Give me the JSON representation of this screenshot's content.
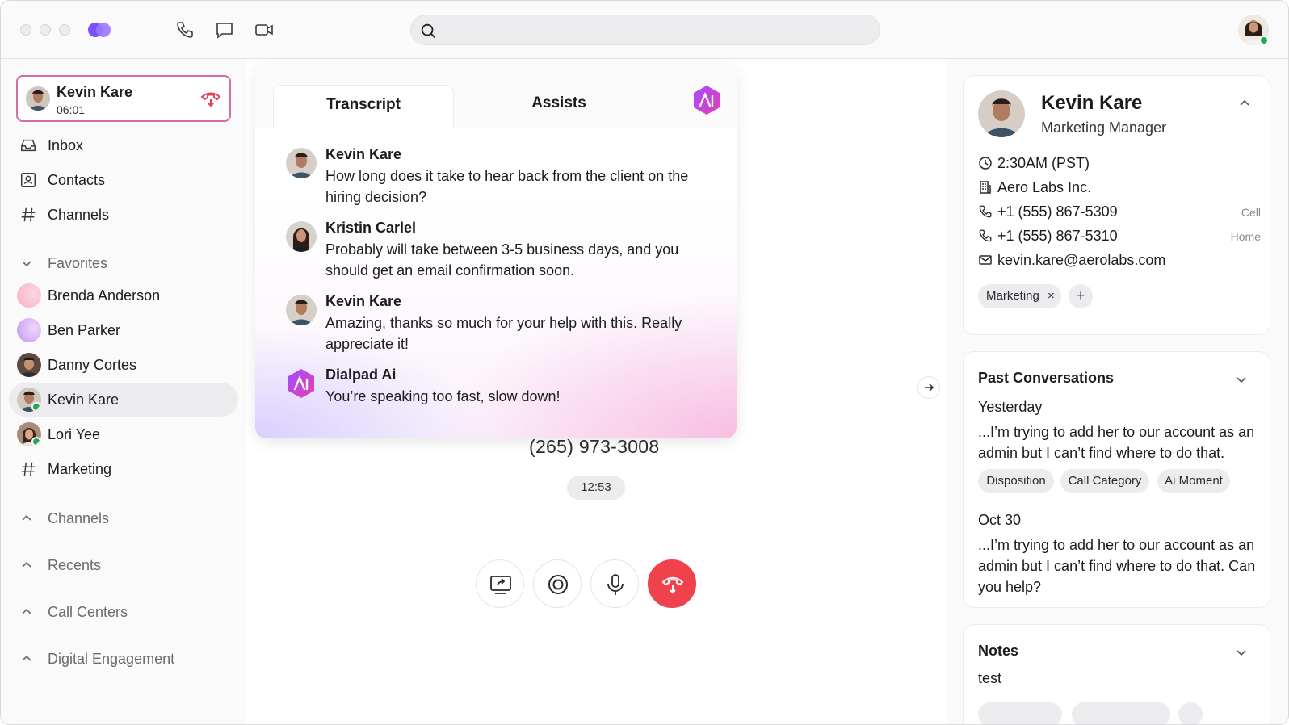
{
  "search": {
    "placeholder": "",
    "value": ""
  },
  "active_call": {
    "name": "Kevin Kare",
    "duration": "06:01"
  },
  "sidebar": {
    "nav": [
      {
        "label": "Inbox"
      },
      {
        "label": "Contacts"
      },
      {
        "label": "Channels"
      }
    ],
    "favorites_label": "Favorites",
    "favorites": [
      {
        "label": "Brenda Anderson"
      },
      {
        "label": "Ben Parker"
      },
      {
        "label": "Danny Cortes"
      },
      {
        "label": "Kevin Kare"
      },
      {
        "label": "Lori Yee"
      },
      {
        "label": "Marketing"
      }
    ],
    "sections": [
      {
        "label": "Channels"
      },
      {
        "label": "Recents"
      },
      {
        "label": "Call Centers"
      },
      {
        "label": "Digital Engagement"
      }
    ]
  },
  "transcript": {
    "tabs": [
      {
        "label": "Transcript"
      },
      {
        "label": "Assists"
      }
    ],
    "messages": [
      {
        "speaker": "Kevin Kare",
        "text": "How long does it take to hear back from the client on the hiring decision?"
      },
      {
        "speaker": "Kristin Carlel",
        "text": "Probably will take between 3-5 business days, and you should get an email confirmation soon."
      },
      {
        "speaker": "Kevin Kare",
        "text": "Amazing, thanks so much for your help with this. Really appreciate it!"
      },
      {
        "speaker": "Dialpad Ai",
        "text": "You’re speaking too fast, slow down!"
      }
    ]
  },
  "call": {
    "phone_number": "(265) 973-3008",
    "elapsed": "12:53"
  },
  "contact": {
    "name": "Kevin Kare",
    "role": "Marketing Manager",
    "local_time": "2:30AM (PST)",
    "company": "Aero Labs Inc.",
    "phones": [
      {
        "number": "+1 (555) 867-5309",
        "type": "Cell"
      },
      {
        "number": "+1 (555) 867-5310",
        "type": "Home"
      }
    ],
    "email": "kevin.kare@aerolabs.com",
    "tags": [
      {
        "label": "Marketing",
        "remove": "×"
      }
    ],
    "add_tag": "+"
  },
  "past_conversations": {
    "title": "Past Conversations",
    "items": [
      {
        "date": "Yesterday",
        "text": "...I’m trying to add her to our account as an admin but I can’t find where to do that.",
        "chips": [
          "Disposition",
          "Call Category",
          "Ai Moment"
        ]
      },
      {
        "date": "Oct 30",
        "text": "...I’m trying to add her to our account as an admin but I can’t find where to do that. Can you help?"
      }
    ]
  },
  "notes": {
    "title": "Notes",
    "text": "test"
  },
  "colors": {
    "accent": "#7c52ff",
    "brand_pink": "#d86aa6",
    "end_call": "#f0424d",
    "online": "#1faa52"
  }
}
